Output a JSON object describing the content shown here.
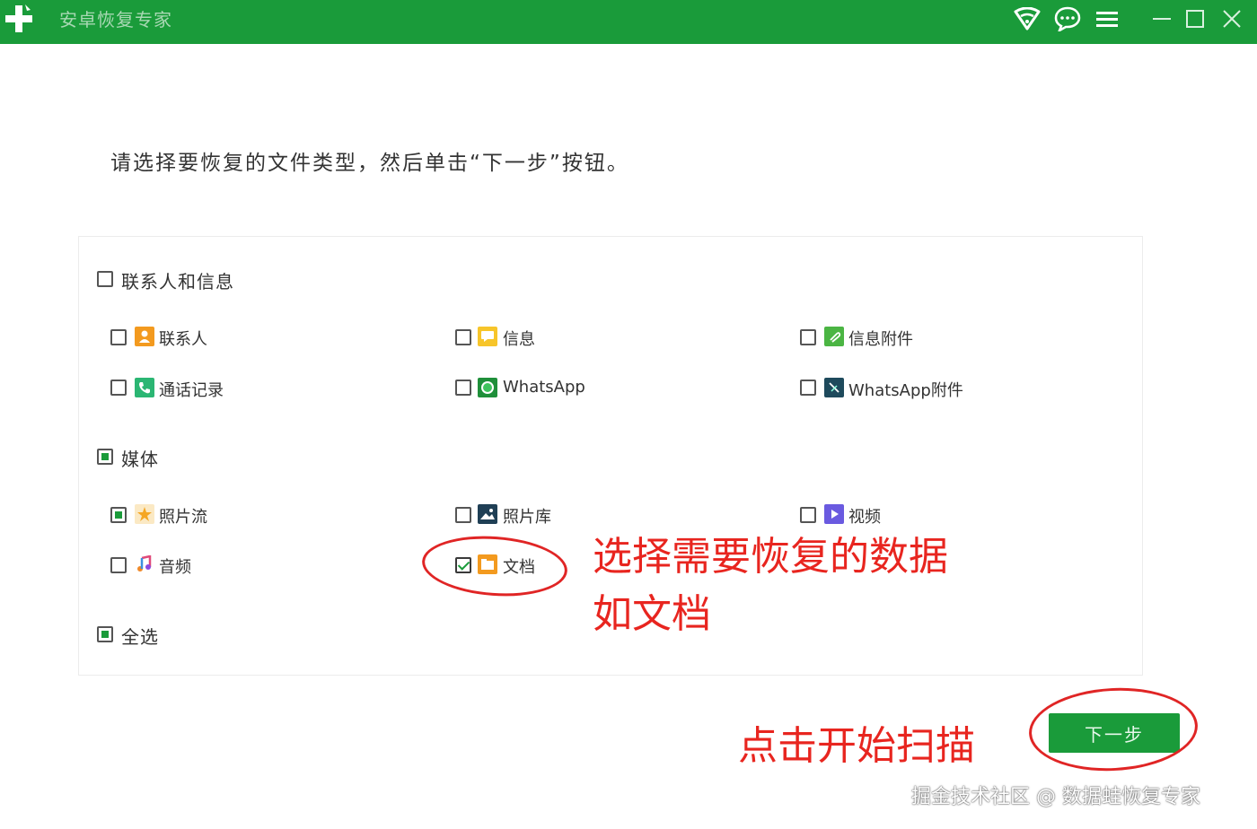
{
  "app": {
    "title": "安卓恢复专家"
  },
  "instruction": "请选择要恢复的文件类型，然后单击“下一步”按钮。",
  "groups": {
    "contacts": {
      "label": "联系人和信息",
      "items": {
        "contacts": "联系人",
        "messages": "信息",
        "message_attachments": "信息附件",
        "call_log": "通话记录",
        "whatsapp": "WhatsApp",
        "whatsapp_attachments": "WhatsApp附件"
      }
    },
    "media": {
      "label": "媒体",
      "items": {
        "photo_stream": "照片流",
        "photo_library": "照片库",
        "video": "视频",
        "audio": "音频",
        "documents": "文档"
      }
    }
  },
  "select_all": "全选",
  "next_button": "下一步",
  "annotations": {
    "select_line1": "选择需要恢复的数据",
    "select_line2": "如文档",
    "start_scan": "点击开始扫描"
  },
  "watermark": "掘金技术社区 @ 数据蛙恢复专家",
  "colors": {
    "brand_green": "#1a9b3a",
    "annotation_red": "#e8251f"
  }
}
